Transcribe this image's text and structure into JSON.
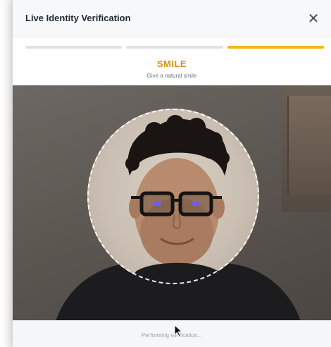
{
  "modal": {
    "title": "Live Identity Verification",
    "close_icon": "close-icon",
    "close_label": "✕"
  },
  "progress": {
    "steps_total": 3,
    "current_step": 3,
    "colors": {
      "inactive": "#dfe3e8",
      "active": "#f4b81c"
    }
  },
  "step": {
    "title": "SMILE",
    "subtitle": "Give a natural smile",
    "title_color": "#d79209"
  },
  "camera": {
    "guide_shape": "dashed-oval"
  },
  "status": {
    "text": "Performing verification..."
  },
  "cursor_icon": "arrow-cursor-icon"
}
